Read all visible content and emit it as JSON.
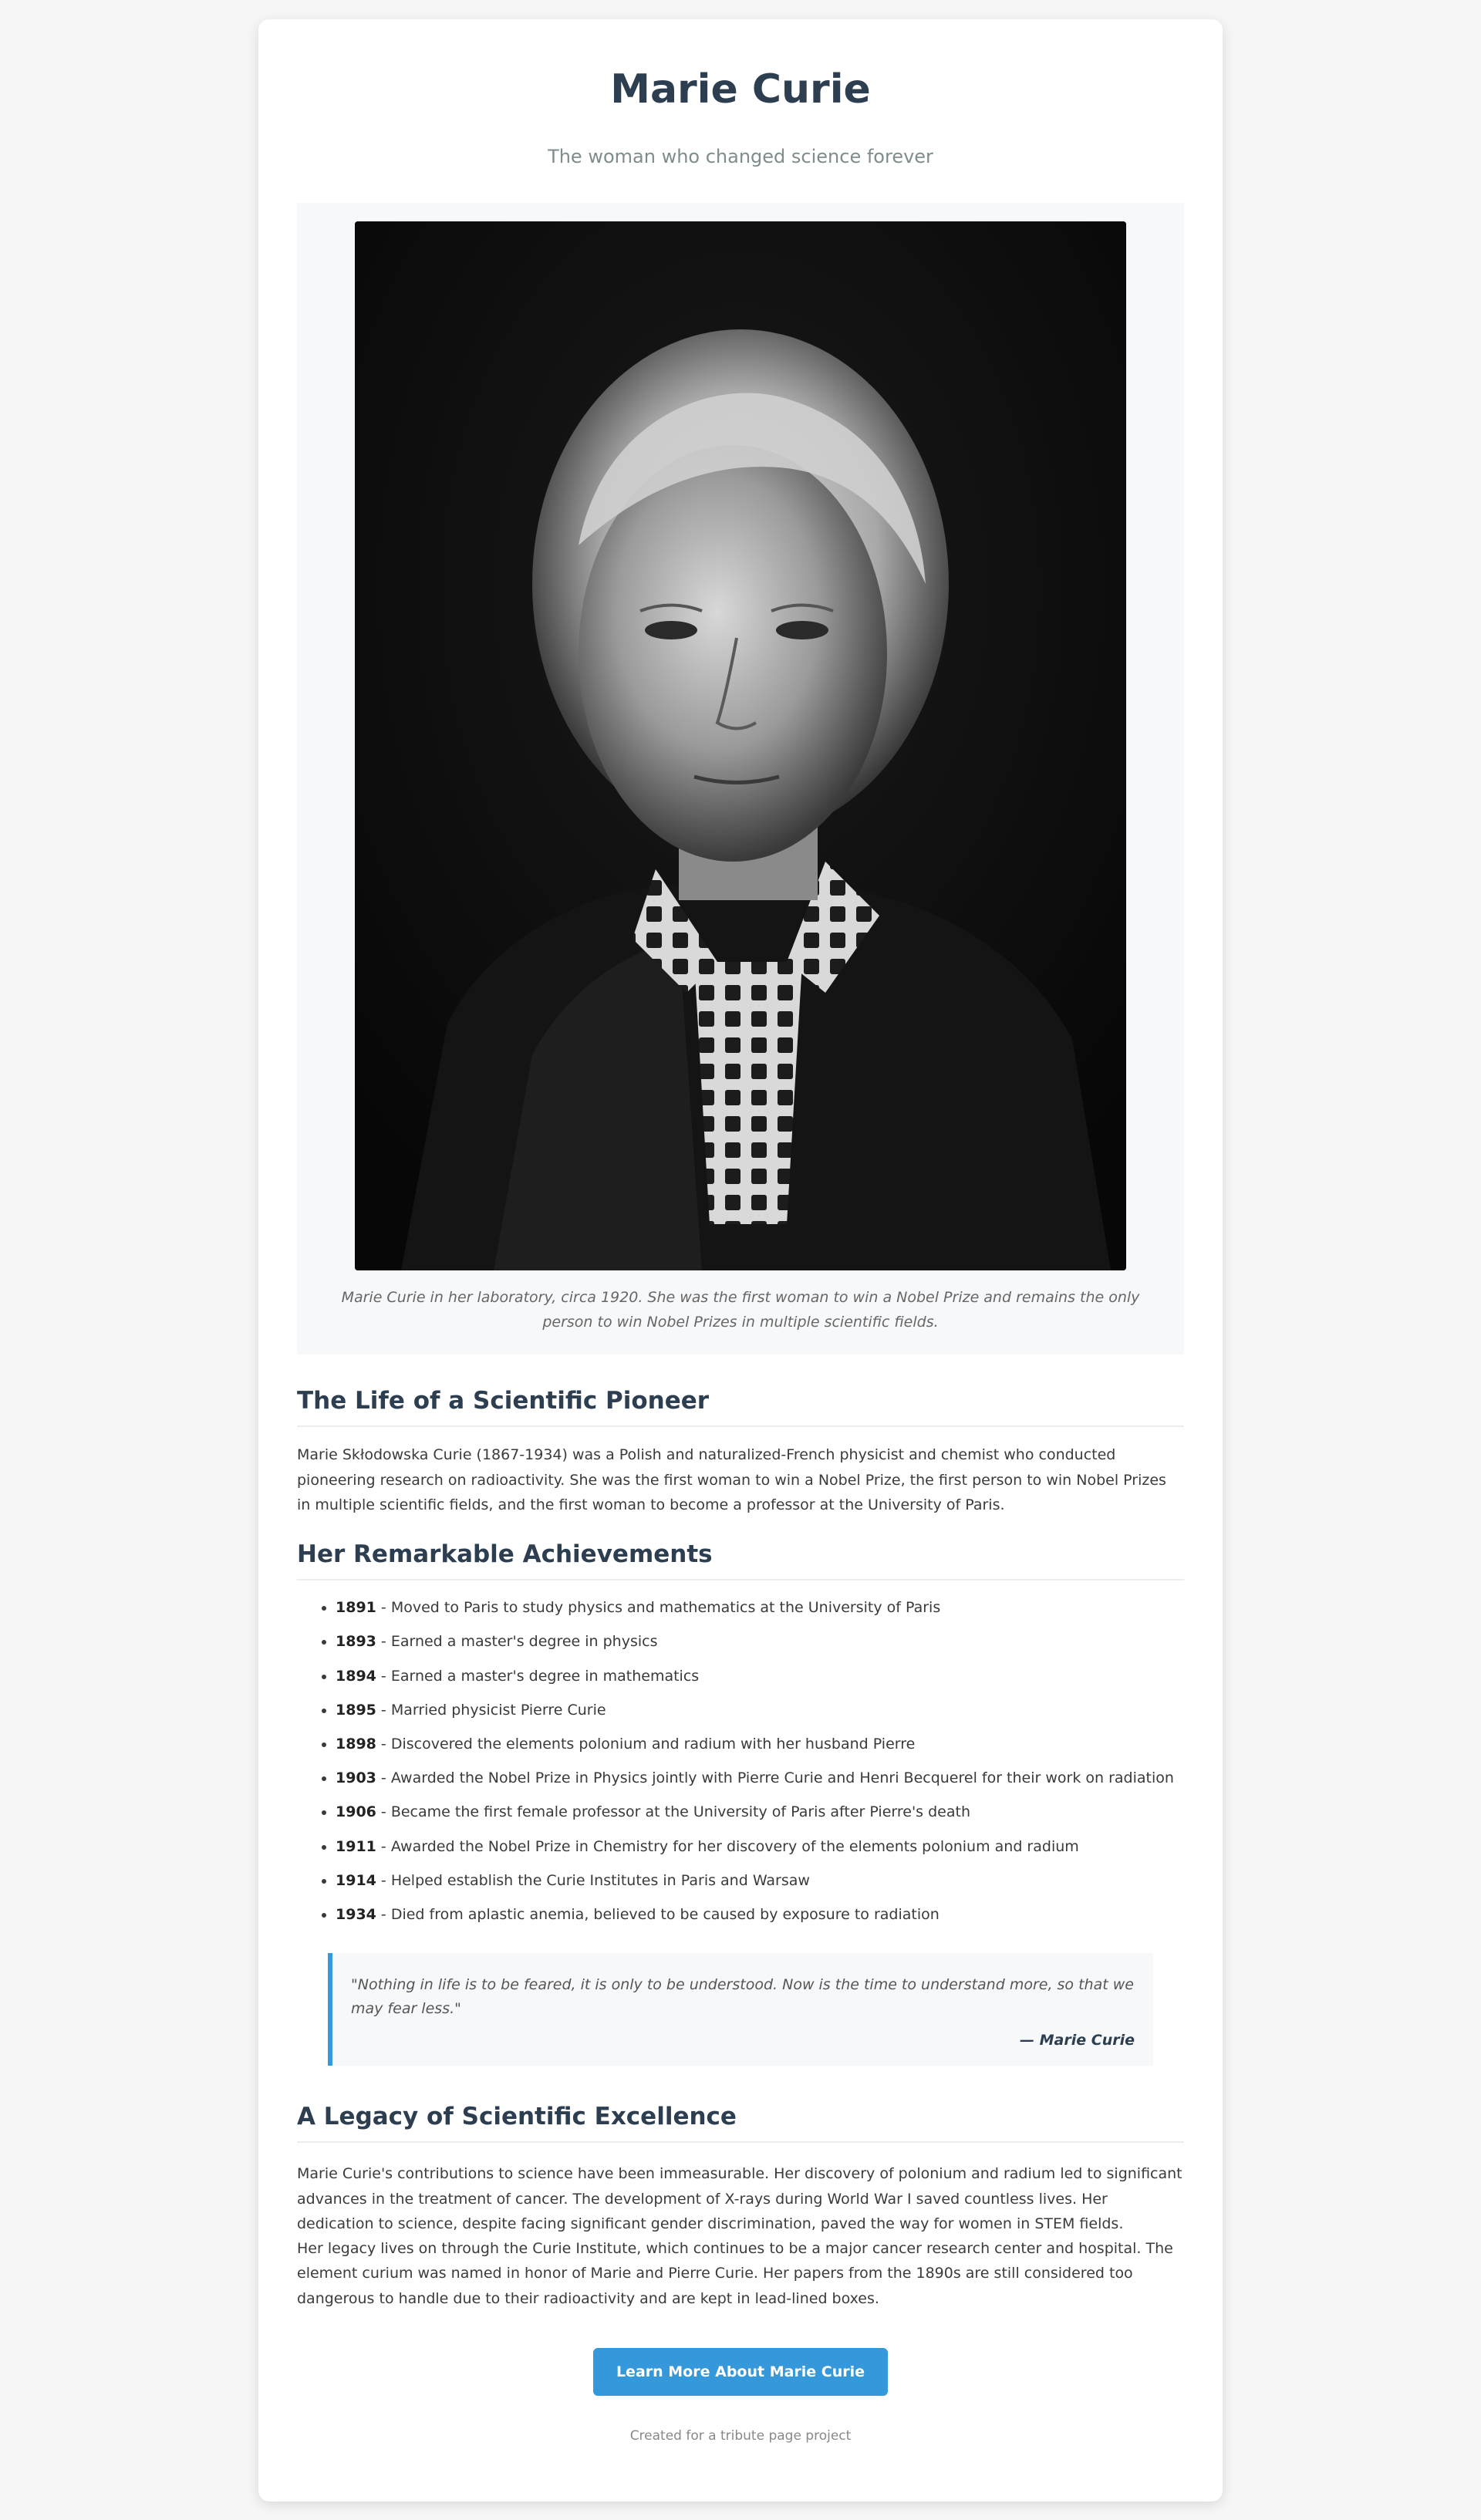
{
  "header": {
    "title": "Marie Curie",
    "subtitle": "The woman who changed science forever"
  },
  "figure": {
    "image_name": "marie-curie-portrait",
    "caption": "Marie Curie in her laboratory, circa 1920. She was the first woman to win a Nobel Prize and remains the only person to win Nobel Prizes in multiple scientific fields."
  },
  "life": {
    "heading": "The Life of a Scientific Pioneer",
    "text": "Marie Skłodowska Curie (1867-1934) was a Polish and naturalized-French physicist and chemist who conducted pioneering research on radioactivity. She was the first woman to win a Nobel Prize, the first person to win Nobel Prizes in multiple scientific fields, and the first woman to become a professor at the University of Paris."
  },
  "achievements": {
    "heading": "Her Remarkable Achievements",
    "items": [
      {
        "year": "1891",
        "text": " - Moved to Paris to study physics and mathematics at the University of Paris"
      },
      {
        "year": "1893",
        "text": " - Earned a master's degree in physics"
      },
      {
        "year": "1894",
        "text": " - Earned a master's degree in mathematics"
      },
      {
        "year": "1895",
        "text": " - Married physicist Pierre Curie"
      },
      {
        "year": "1898",
        "text": " - Discovered the elements polonium and radium with her husband Pierre"
      },
      {
        "year": "1903",
        "text": " - Awarded the Nobel Prize in Physics jointly with Pierre Curie and Henri Becquerel for their work on radiation"
      },
      {
        "year": "1906",
        "text": " - Became the first female professor at the University of Paris after Pierre's death"
      },
      {
        "year": "1911",
        "text": " - Awarded the Nobel Prize in Chemistry for her discovery of the elements polonium and radium"
      },
      {
        "year": "1914",
        "text": " - Helped establish the Curie Institutes in Paris and Warsaw"
      },
      {
        "year": "1934",
        "text": " - Died from aplastic anemia, believed to be caused by exposure to radiation"
      }
    ]
  },
  "quote": {
    "text": "\"Nothing in life is to be feared, it is only to be understood. Now is the time to understand more, so that we may fear less.\"",
    "author": "— Marie Curie"
  },
  "legacy": {
    "heading": "A Legacy of Scientific Excellence",
    "paragraphs": [
      "Marie Curie's contributions to science have been immeasurable. Her discovery of polonium and radium led to significant advances in the treatment of cancer. The development of X-rays during World War I saved countless lives. Her dedication to science, despite facing significant gender discrimination, paved the way for women in STEM fields.",
      "Her legacy lives on through the Curie Institute, which continues to be a major cancer research center and hospital. The element curium was named in honor of Marie and Pierre Curie. Her papers from the 1890s are still considered too dangerous to handle due to their radioactivity and are kept in lead-lined boxes."
    ]
  },
  "cta": {
    "label": "Learn More About Marie Curie"
  },
  "footer": {
    "text": "Created for a tribute page project"
  },
  "colors": {
    "accent": "#3498db",
    "heading": "#2c3e50",
    "background": "#f6f6f6"
  }
}
